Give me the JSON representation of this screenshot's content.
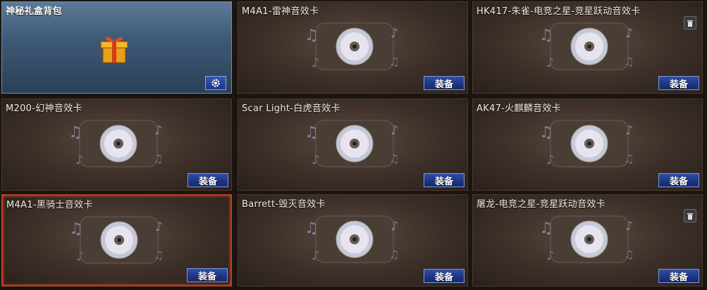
{
  "equip_label": "装备",
  "cards": [
    {
      "title": "神秘礼盒背包",
      "kind": "giftbox"
    },
    {
      "title": "M4A1-雷神音效卡",
      "kind": "sound"
    },
    {
      "title": "HK417-朱雀-电竞之星-竞星跃动音效卡",
      "kind": "sound",
      "trash": true
    },
    {
      "title": "M200-幻神音效卡",
      "kind": "sound"
    },
    {
      "title": "Scar Light-白虎音效卡",
      "kind": "sound"
    },
    {
      "title": "AK47-火麒麟音效卡",
      "kind": "sound"
    },
    {
      "title": "M4A1-黑骑士音效卡",
      "kind": "sound",
      "selected": true
    },
    {
      "title": "Barrett-毁灭音效卡",
      "kind": "sound"
    },
    {
      "title": "屠龙-电竞之星-竞星跃动音效卡",
      "kind": "sound",
      "trash": true
    }
  ],
  "icons": {
    "sound_card_art": "cd-disc-icon",
    "gift": "gift-box-icon",
    "settings": "gear-icon",
    "delete": "trash-icon"
  },
  "colors": {
    "equip_button": "#1d3580",
    "selected_border": "#c0401e",
    "giftbox_card": "#3f5a76"
  }
}
